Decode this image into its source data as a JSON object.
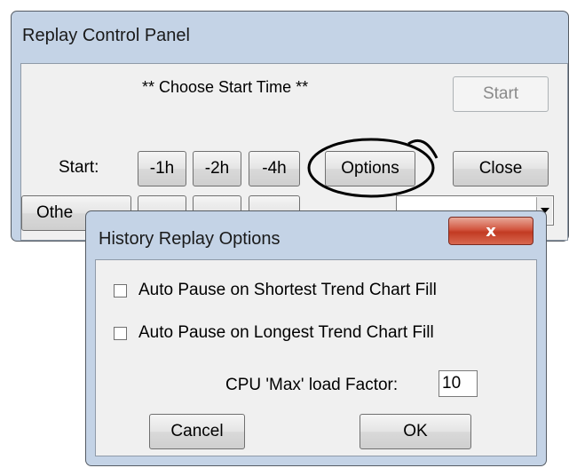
{
  "replay_panel": {
    "title": "Replay Control Panel",
    "status_text": "** Choose Start Time **",
    "start_button": "Start",
    "start_label": "Start:",
    "minus_1h": "-1h",
    "minus_2h": "-2h",
    "minus_4h": "-4h",
    "options_button": "Options",
    "close_button": "Close",
    "other_button_partial": "Othe"
  },
  "options_dialog": {
    "title": "History Replay Options",
    "close_glyph": "x",
    "auto_pause_shortest": {
      "label": "Auto Pause on Shortest Trend Chart Fill",
      "checked": false
    },
    "auto_pause_longest": {
      "label": "Auto Pause on Longest Trend Chart Fill",
      "checked": false
    },
    "cpu_label": "CPU 'Max' load Factor:",
    "cpu_value": "10",
    "cancel_button": "Cancel",
    "ok_button": "OK"
  },
  "annotation": {
    "color": "#000000",
    "highlight": "options-button"
  }
}
